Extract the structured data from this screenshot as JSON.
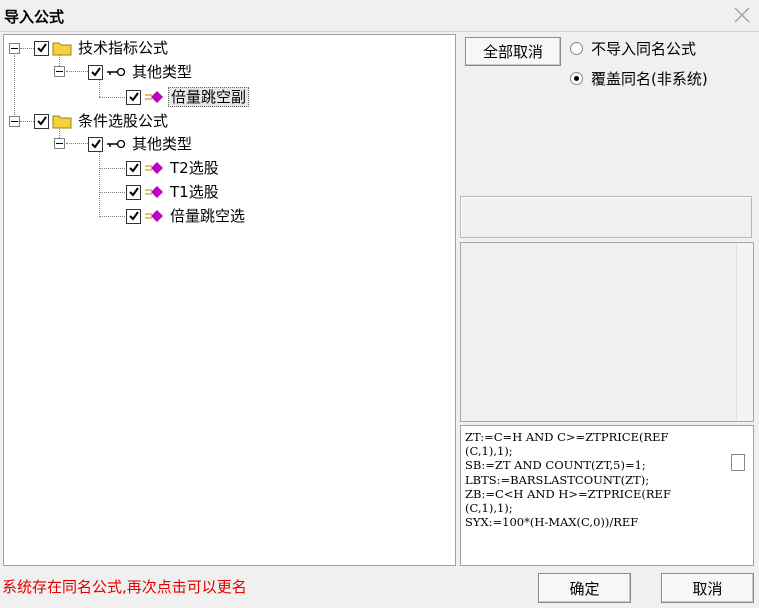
{
  "window": {
    "title": "导入公式"
  },
  "tree": {
    "group1": {
      "label": "技术指标公式",
      "type": {
        "label": "其他类型",
        "items": [
          "倍量跳空副"
        ]
      }
    },
    "group2": {
      "label": "条件选股公式",
      "type": {
        "label": "其他类型",
        "items": [
          "T2选股",
          "T1选股",
          "倍量跳空选"
        ]
      }
    }
  },
  "buttons": {
    "cancel_all": "全部取消",
    "ok": "确定",
    "cancel": "取消"
  },
  "radio": {
    "no_import": "不导入同名公式",
    "overwrite": "覆盖同名(非系统)",
    "selected": "overwrite"
  },
  "code": "ZT:=C=H AND C>=ZTPRICE(REF\n(C,1),1);\nSB:=ZT AND COUNT(ZT,5)=1;\nLBTS:=BARSLASTCOUNT(ZT);\nZB:=C<H AND H>=ZTPRICE(REF\n(C,1),1);\nSYX:=100*(H-MAX(C,0))/REF",
  "status": "系统存在同名公式,再次点击可以更名",
  "colors": {
    "status": "#e00000",
    "folder": "#f5d23c",
    "formula_diamond": "#c000c0"
  },
  "icons": {
    "close": "close-icon",
    "folder": "folder-icon",
    "key": "key-icon",
    "formula": "formula-icon"
  }
}
